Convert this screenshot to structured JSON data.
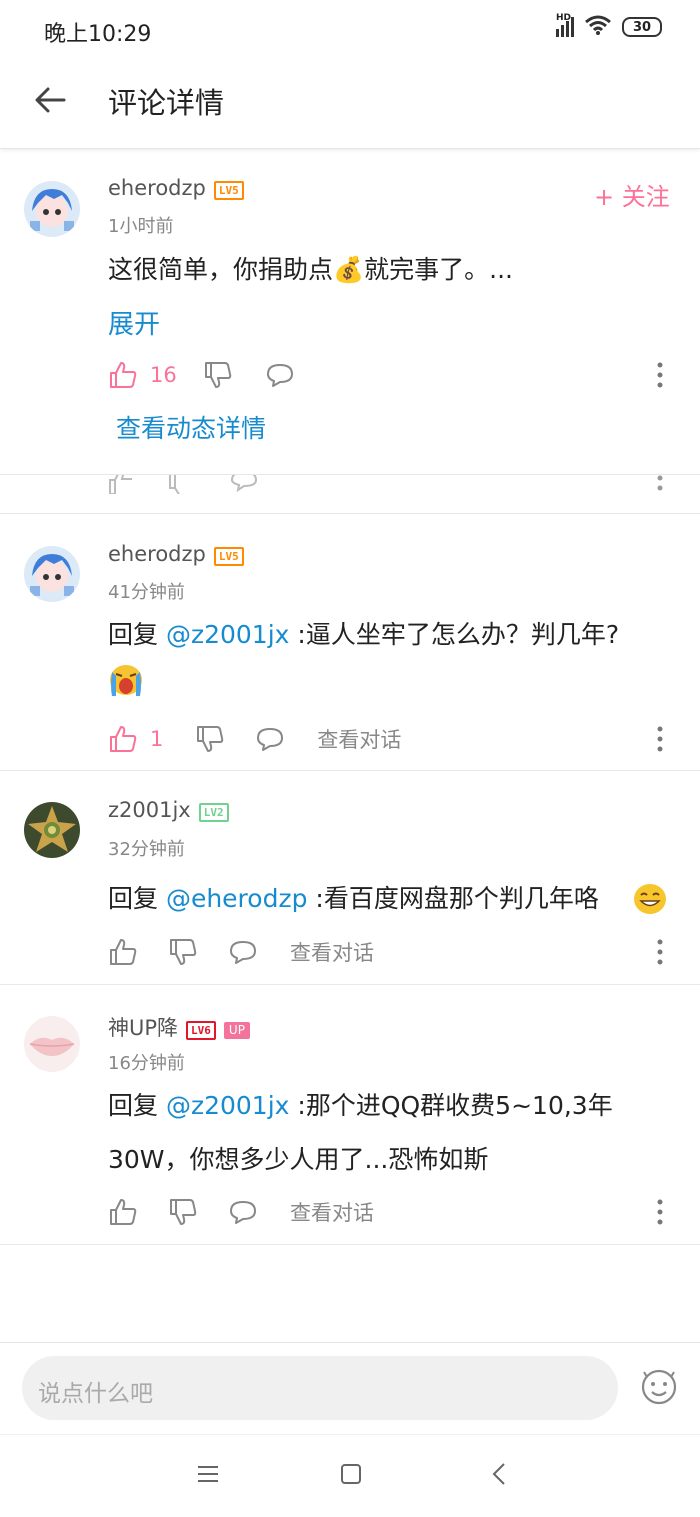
{
  "status_bar": {
    "time": "晚上10:29",
    "network": "HD",
    "battery": "30"
  },
  "header": {
    "title": "评论详情"
  },
  "main_comment": {
    "username": "eherodzp",
    "level": "LV5",
    "time": "1小时前",
    "follow_label": "+ 关注",
    "text_before": "这很简单，你捐助点",
    "emoji": "💰",
    "text_after": "就完事了。...",
    "expand_label": "展开",
    "like_count": "16",
    "dynamic_link": "查看动态详情"
  },
  "replies": [
    {
      "username": "eherodzp",
      "level": "LV5",
      "time": "41分钟前",
      "prefix": "回复 ",
      "mention": "@z2001jx",
      "text": " :逼人坐牢了怎么办？判几年?",
      "like_count": "1",
      "view_conv": "查看对话"
    },
    {
      "username": "z2001jx",
      "level": "LV2",
      "time": "32分钟前",
      "prefix": "回复 ",
      "mention": "@eherodzp",
      "text": " :看百度网盘那个判几年咯",
      "view_conv": "查看对话"
    },
    {
      "username": "神UP降",
      "level": "LV6",
      "up_badge": "UP",
      "time": "16分钟前",
      "prefix": "回复 ",
      "mention": "@z2001jx",
      "text": " :那个进QQ群收费5~10,3年",
      "text_line2": "30W，你想多少人用了...恐怖如斯",
      "view_conv": "查看对话"
    }
  ],
  "input": {
    "placeholder": "说点什么吧"
  },
  "colors": {
    "pink": "#fb7299",
    "link_blue": "#178bcf",
    "lv5": "#ff8a00",
    "lv2": "#6fd28f",
    "lv6": "#e0162b"
  }
}
